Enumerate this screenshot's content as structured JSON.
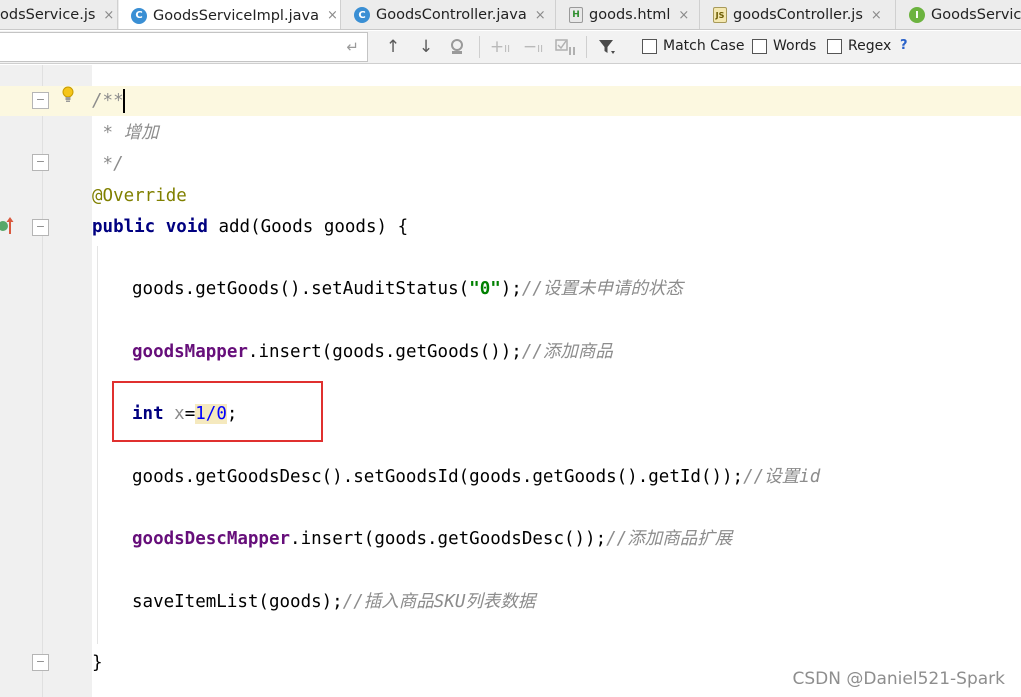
{
  "tabs": [
    {
      "label": "odsService.js",
      "icon": "js-file-icon",
      "closable": true,
      "active": false
    },
    {
      "label": "GoodsServiceImpl.java",
      "icon": "java-class-icon",
      "closable": true,
      "active": true
    },
    {
      "label": "GoodsController.java",
      "icon": "java-class-icon",
      "closable": true,
      "active": false
    },
    {
      "label": "goods.html",
      "icon": "html-file-icon",
      "closable": true,
      "active": false
    },
    {
      "label": "goodsController.js",
      "icon": "js-file-icon",
      "closable": true,
      "active": false
    },
    {
      "label": "GoodsServic",
      "icon": "java-interface-icon",
      "closable": false,
      "active": false
    }
  ],
  "tab_icon_letters": {
    "c": "C",
    "i": "I",
    "h": "H",
    "js": "JS"
  },
  "tab_close_glyph": "×",
  "search": {
    "value": "",
    "options": {
      "match_case": "Match Case",
      "words": "Words",
      "regex": "Regex",
      "help": "?"
    }
  },
  "code": {
    "javadoc_open": "/**",
    "javadoc_text": " * 增加",
    "javadoc_close": " */",
    "annotation": "@Override",
    "method": {
      "kw_public": "public",
      "kw_void": "void",
      "rest": " add(Goods goods) {"
    },
    "line_audit": {
      "code1": "goods.getGoods().setAuditStatus(",
      "str": "\"0\"",
      "code2": ");",
      "comment": "//设置未申请的状态"
    },
    "line_insert": {
      "field": "goodsMapper",
      "code": ".insert(goods.getGoods());",
      "comment": "//添加商品"
    },
    "line_int": {
      "kw": "int",
      "var": "x",
      "eq": "=",
      "expr": "1/0",
      "semi": ";"
    },
    "line_setid": {
      "code": "goods.getGoodsDesc().setGoodsId(goods.getGoods().getId());",
      "comment": "//设置id"
    },
    "line_desc": {
      "field": "goodsDescMapper",
      "code": ".insert(goods.getGoodsDesc());",
      "comment": "//添加商品扩展"
    },
    "line_save": {
      "code": "saveItemList(goods);",
      "comment": "//插入商品SKU列表数据"
    },
    "close_brace": "}"
  },
  "watermark": "CSDN @Daniel521-Spark"
}
